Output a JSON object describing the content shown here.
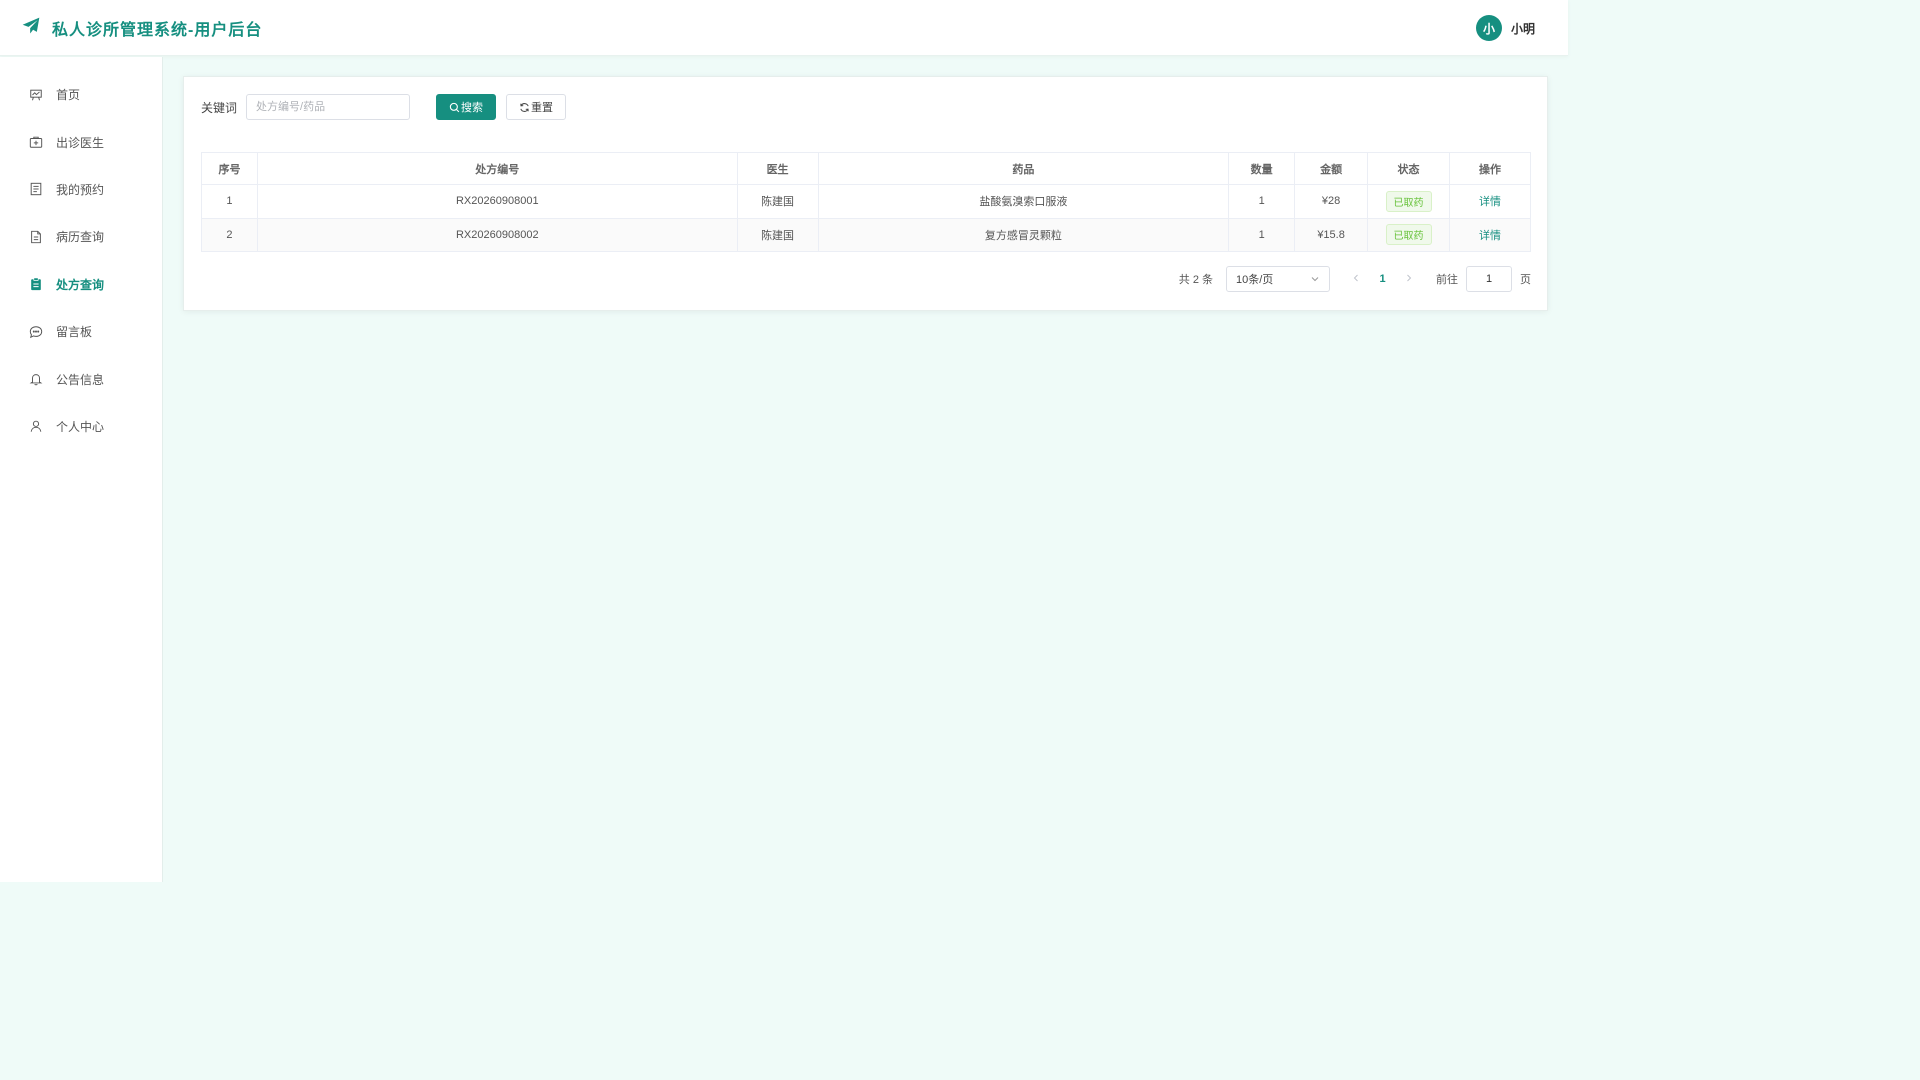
{
  "app": {
    "title": "私人诊所管理系统-用户后台",
    "logo_icon": "paper-plane-icon",
    "accent": "#168f80"
  },
  "user": {
    "avatar_text": "小",
    "name": "小明"
  },
  "sidebar": {
    "items": [
      {
        "label": "首页",
        "icon": "presentation-board-icon"
      },
      {
        "label": "出诊医生",
        "icon": "medical-kit-icon"
      },
      {
        "label": "我的预约",
        "icon": "document-list-icon"
      },
      {
        "label": "病历查询",
        "icon": "file-text-icon"
      },
      {
        "label": "处方查询",
        "icon": "clipboard-icon",
        "active": true
      },
      {
        "label": "留言板",
        "icon": "chat-bubble-icon"
      },
      {
        "label": "公告信息",
        "icon": "bell-icon"
      },
      {
        "label": "个人中心",
        "icon": "user-icon"
      }
    ]
  },
  "search": {
    "label": "关键词",
    "placeholder": "处方编号/药品",
    "value": "",
    "search_button": "搜索",
    "reset_button": "重置"
  },
  "table": {
    "columns": [
      "序号",
      "处方编号",
      "医生",
      "药品",
      "数量",
      "金额",
      "状态",
      "操作"
    ],
    "rows": [
      {
        "index": "1",
        "rx_no": "RX20260908001",
        "doctor": "陈建国",
        "drug": "盐酸氨溴索口服液",
        "qty": "1",
        "amount": "¥28",
        "status": "已取药",
        "action": "详情"
      },
      {
        "index": "2",
        "rx_no": "RX20260908002",
        "doctor": "陈建国",
        "drug": "复方感冒灵颗粒",
        "qty": "1",
        "amount": "¥15.8",
        "status": "已取药",
        "action": "详情"
      }
    ]
  },
  "pagination": {
    "total_text": "共 2 条",
    "page_size": "10条/页",
    "current_page": "1",
    "goto_label": "前往",
    "goto_value": "1",
    "page_suffix": "页"
  }
}
